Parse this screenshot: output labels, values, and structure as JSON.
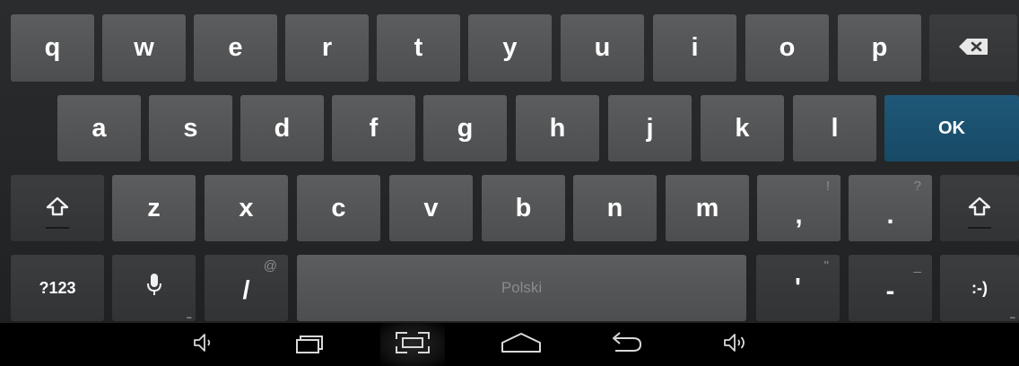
{
  "keyboard": {
    "row1": [
      "q",
      "w",
      "e",
      "r",
      "t",
      "y",
      "u",
      "i",
      "o",
      "p"
    ],
    "row2": [
      "a",
      "s",
      "d",
      "f",
      "g",
      "h",
      "j",
      "k",
      "l"
    ],
    "row3": [
      "z",
      "x",
      "c",
      "v",
      "b",
      "n",
      "m"
    ],
    "ok_label": "OK",
    "comma_label": ",",
    "comma_hint": "!",
    "period_label": ".",
    "period_hint": "?",
    "symbols_label": "?123",
    "slash_label": "/",
    "slash_hint": "@",
    "space_label": "Polski",
    "apostrophe_label": "'",
    "apostrophe_hint": "\"",
    "dash_label": "-",
    "dash_hint": "_",
    "smiley_label": ":-)",
    "more_dots": "..."
  },
  "icons": {
    "backspace": "backspace-icon",
    "shift": "shift-icon",
    "mic": "microphone-icon",
    "volume_down": "volume-down-icon",
    "recent_apps": "recent-apps-icon",
    "screenshot": "screenshot-icon",
    "home": "home-icon",
    "back": "back-icon",
    "volume_up": "volume-up-icon"
  },
  "colors": {
    "key": "#555657",
    "key_dark": "#373839",
    "ok": "#1b5171",
    "keyboard_bg": "#252729"
  }
}
